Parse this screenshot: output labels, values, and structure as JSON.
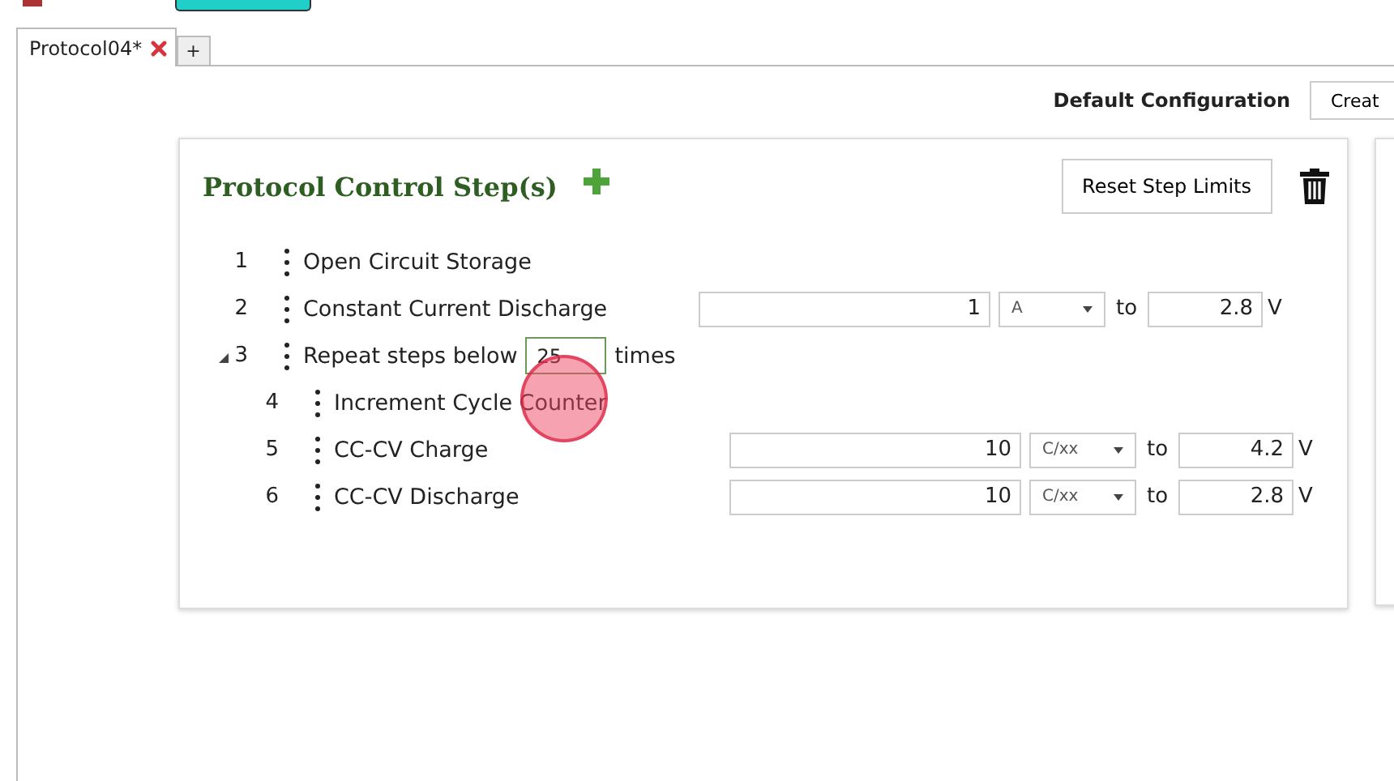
{
  "tabs": [
    {
      "label": "Protocol04*",
      "selected": true,
      "closable": true
    },
    {
      "label": "+",
      "selected": false,
      "closable": false
    }
  ],
  "configuration": {
    "label": "Default Configuration",
    "button": "Creat"
  },
  "panel": {
    "title": "Protocol Control Step(s)",
    "reset_button": "Reset Step Limits",
    "steps": [
      {
        "number": "1",
        "kind": "plain",
        "name": "Open Circuit Storage"
      },
      {
        "number": "2",
        "kind": "limits",
        "name": "Constant Current Discharge",
        "value": "1",
        "unit": "A",
        "to": "to",
        "limit": "2.8",
        "limit_unit": "V"
      },
      {
        "number": "3",
        "kind": "repeat",
        "expanded": true,
        "name": "Repeat steps below",
        "count": "25",
        "suffix": "times",
        "children": [
          {
            "number": "4",
            "kind": "plain",
            "name": "Increment Cycle Counter"
          },
          {
            "number": "5",
            "kind": "limits",
            "name": "CC-CV Charge",
            "value": "10",
            "unit": "C/xx",
            "to": "to",
            "limit": "4.2",
            "limit_unit": "V"
          },
          {
            "number": "6",
            "kind": "limits",
            "name": "CC-CV Discharge",
            "value": "10",
            "unit": "C/xx",
            "to": "to",
            "limit": "2.8",
            "limit_unit": "V"
          }
        ]
      }
    ]
  }
}
